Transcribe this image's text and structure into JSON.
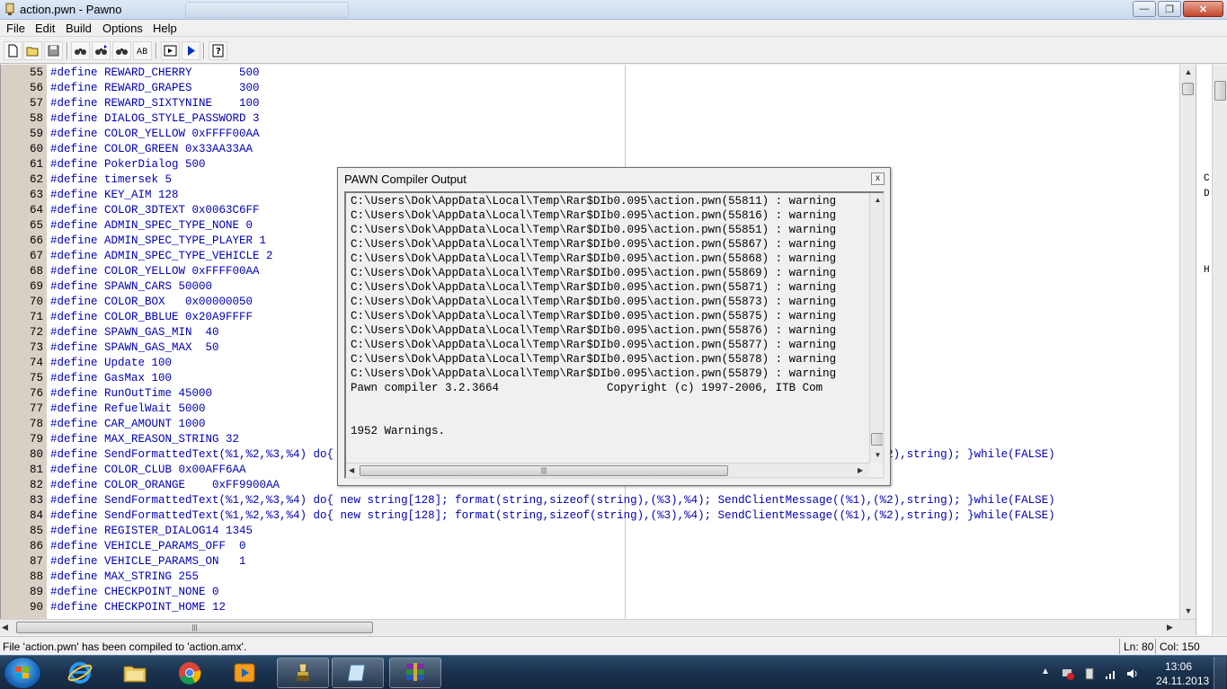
{
  "window": {
    "title": "action.pwn - Pawno",
    "minimize": "—",
    "maximize": "❐",
    "close": "✕"
  },
  "menu": [
    "File",
    "Edit",
    "Build",
    "Options",
    "Help"
  ],
  "toolbar": {
    "icons": [
      "new-file-icon",
      "open-file-icon",
      "save-icon",
      "find-icon",
      "find-next-icon",
      "replace-icon",
      "goto-icon",
      "compile-icon",
      "compile-run-icon",
      "help-icon"
    ]
  },
  "editor": {
    "lines": [
      {
        "no": "55",
        "code": "#define REWARD_CHERRY       500"
      },
      {
        "no": "56",
        "code": "#define REWARD_GRAPES       300"
      },
      {
        "no": "57",
        "code": "#define REWARD_SIXTYNINE    100"
      },
      {
        "no": "58",
        "code": "#define DIALOG_STYLE_PASSWORD 3"
      },
      {
        "no": "59",
        "code": "#define COLOR_YELLOW 0xFFFF00AA"
      },
      {
        "no": "60",
        "code": "#define COLOR_GREEN 0x33AA33AA"
      },
      {
        "no": "61",
        "code": "#define PokerDialog 500"
      },
      {
        "no": "62",
        "code": "#define timersek 5"
      },
      {
        "no": "63",
        "code": "#define KEY_AIM 128"
      },
      {
        "no": "64",
        "code": "#define COLOR_3DTEXT 0x0063C6FF"
      },
      {
        "no": "65",
        "code": "#define ADMIN_SPEC_TYPE_NONE 0"
      },
      {
        "no": "66",
        "code": "#define ADMIN_SPEC_TYPE_PLAYER 1"
      },
      {
        "no": "67",
        "code": "#define ADMIN_SPEC_TYPE_VEHICLE 2"
      },
      {
        "no": "68",
        "code": "#define COLOR_YELLOW 0xFFFF00AA"
      },
      {
        "no": "69",
        "code": "#define SPAWN_CARS 50000"
      },
      {
        "no": "70",
        "code": "#define COLOR_BOX   0x00000050"
      },
      {
        "no": "71",
        "code": "#define COLOR_BBLUE 0x20A9FFFF"
      },
      {
        "no": "72",
        "code": "#define SPAWN_GAS_MIN  40"
      },
      {
        "no": "73",
        "code": "#define SPAWN_GAS_MAX  50"
      },
      {
        "no": "74",
        "code": "#define Update 100"
      },
      {
        "no": "75",
        "code": "#define GasMax 100"
      },
      {
        "no": "76",
        "code": "#define RunOutTime 45000"
      },
      {
        "no": "77",
        "code": "#define RefuelWait 5000"
      },
      {
        "no": "78",
        "code": "#define CAR_AMOUNT 1000"
      },
      {
        "no": "79",
        "code": "#define MAX_REASON_STRING 32"
      },
      {
        "no": "80",
        "code": "#define SendFormattedText(%1,%2,%3,%4) do{ new string[128]; format(string,sizeof(string),(%3),%4); SendClientMessage((%1),(%2),string); }while(FALSE)"
      },
      {
        "no": "81",
        "code": "#define COLOR_CLUB 0x00AFF6AA"
      },
      {
        "no": "82",
        "code": "#define COLOR_ORANGE    0xFF9900AA"
      },
      {
        "no": "83",
        "code": "#define SendFormattedText(%1,%2,%3,%4) do{ new string[128]; format(string,sizeof(string),(%3),%4); SendClientMessage((%1),(%2),string); }while(FALSE)"
      },
      {
        "no": "84",
        "code": "#define SendFormattedText(%1,%2,%3,%4) do{ new string[128]; format(string,sizeof(string),(%3),%4); SendClientMessage((%1),(%2),string); }while(FALSE)"
      },
      {
        "no": "85",
        "code": "#define REGISTER_DIALOG14 1345"
      },
      {
        "no": "86",
        "code": "#define VEHICLE_PARAMS_OFF  0"
      },
      {
        "no": "87",
        "code": "#define VEHICLE_PARAMS_ON   1"
      },
      {
        "no": "88",
        "code": "#define MAX_STRING 255"
      },
      {
        "no": "89",
        "code": "#define CHECKPOINT_NONE 0"
      },
      {
        "no": "90",
        "code": "#define CHECKPOINT_HOME 12"
      }
    ]
  },
  "dialog": {
    "title": "PAWN Compiler Output",
    "close_label": "x",
    "lines": [
      "C:\\Users\\Dok\\AppData\\Local\\Temp\\Rar$DIb0.095\\action.pwn(55811) : warning",
      "C:\\Users\\Dok\\AppData\\Local\\Temp\\Rar$DIb0.095\\action.pwn(55816) : warning",
      "C:\\Users\\Dok\\AppData\\Local\\Temp\\Rar$DIb0.095\\action.pwn(55851) : warning",
      "C:\\Users\\Dok\\AppData\\Local\\Temp\\Rar$DIb0.095\\action.pwn(55867) : warning",
      "C:\\Users\\Dok\\AppData\\Local\\Temp\\Rar$DIb0.095\\action.pwn(55868) : warning",
      "C:\\Users\\Dok\\AppData\\Local\\Temp\\Rar$DIb0.095\\action.pwn(55869) : warning",
      "C:\\Users\\Dok\\AppData\\Local\\Temp\\Rar$DIb0.095\\action.pwn(55871) : warning",
      "C:\\Users\\Dok\\AppData\\Local\\Temp\\Rar$DIb0.095\\action.pwn(55873) : warning",
      "C:\\Users\\Dok\\AppData\\Local\\Temp\\Rar$DIb0.095\\action.pwn(55875) : warning",
      "C:\\Users\\Dok\\AppData\\Local\\Temp\\Rar$DIb0.095\\action.pwn(55876) : warning",
      "C:\\Users\\Dok\\AppData\\Local\\Temp\\Rar$DIb0.095\\action.pwn(55877) : warning",
      "C:\\Users\\Dok\\AppData\\Local\\Temp\\Rar$DIb0.095\\action.pwn(55878) : warning",
      "C:\\Users\\Dok\\AppData\\Local\\Temp\\Rar$DIb0.095\\action.pwn(55879) : warning",
      "Pawn compiler 3.2.3664                Copyright (c) 1997-2006, ITB Com",
      "",
      "",
      "1952 Warnings."
    ]
  },
  "status": {
    "message": "File 'action.pwn' has been compiled to 'action.amx'.",
    "line": "Ln: 80",
    "column": "Col: 150"
  },
  "background_window_chars": [
    {
      "char": "C",
      "row": 7
    },
    {
      "char": "D",
      "row": 8
    },
    {
      "char": "H",
      "row": 13
    }
  ],
  "taskbar": {
    "apps": [
      "internet-explorer-icon",
      "file-explorer-icon",
      "chrome-icon",
      "media-player-icon",
      "pawno-icon",
      "notepad-icon",
      "winrar-icon"
    ],
    "time": "13:06",
    "date": "24.11.2013"
  }
}
